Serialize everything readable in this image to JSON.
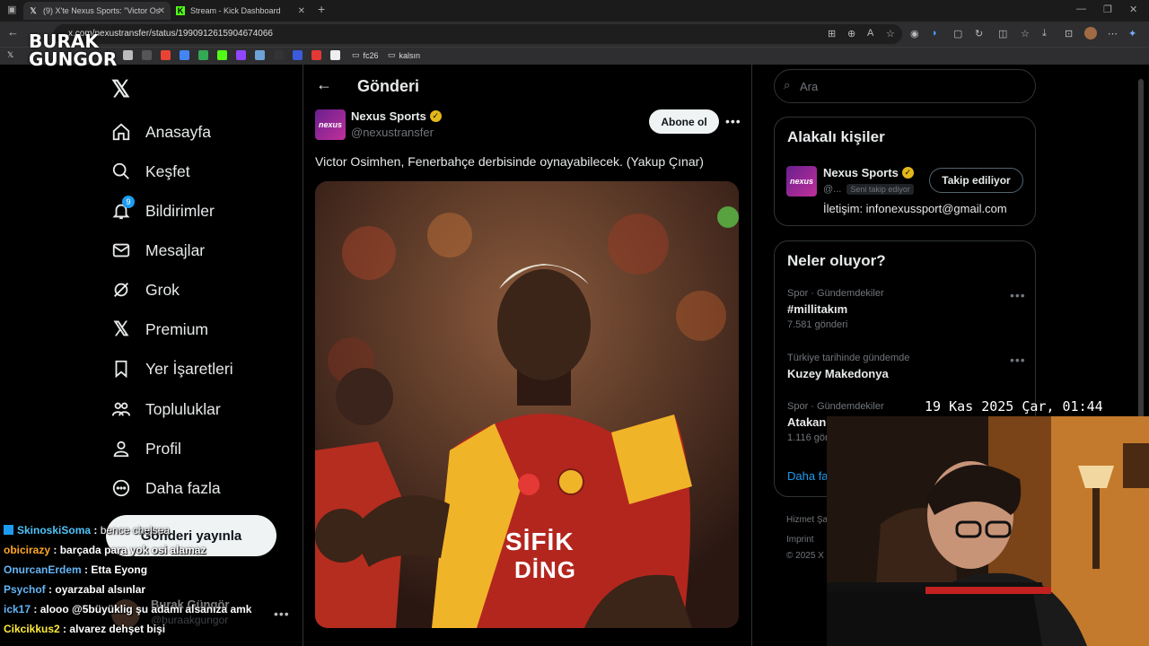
{
  "browser": {
    "tabs": [
      {
        "title": "(9) X'te Nexus Sports: \"Victor Os",
        "icon": "x-logo-icon"
      },
      {
        "title": "Stream - Kick Dashboard",
        "icon": "kick-icon"
      }
    ],
    "url": "x.com/nexustransfer/status/1990912615904674066",
    "bookmarks": [
      {
        "label": "fc26",
        "icon": "folder-icon"
      },
      {
        "label": "kalsın",
        "icon": "folder-icon"
      }
    ]
  },
  "overlay": {
    "logo_line1": "BURAK",
    "logo_line2": "GUNGOR",
    "clock": "19 Kas 2025 Çar, 01:44"
  },
  "nav": {
    "items": [
      {
        "label": "Anasayfa",
        "icon": "home-icon"
      },
      {
        "label": "Keşfet",
        "icon": "search-icon"
      },
      {
        "label": "Bildirimler",
        "icon": "bell-icon",
        "badge": "9"
      },
      {
        "label": "Mesajlar",
        "icon": "mail-icon"
      },
      {
        "label": "Grok",
        "icon": "grok-icon"
      },
      {
        "label": "Premium",
        "icon": "x-logo-icon"
      },
      {
        "label": "Yer İşaretleri",
        "icon": "bookmark-icon"
      },
      {
        "label": "Topluluklar",
        "icon": "communities-icon"
      },
      {
        "label": "Profil",
        "icon": "profile-icon"
      },
      {
        "label": "Daha fazla",
        "icon": "more-circle-icon"
      }
    ],
    "post_button": "Gönderi yayınla",
    "account_name": "Burak Güngör",
    "account_handle": "@buraakgungor"
  },
  "post": {
    "header_title": "Gönderi",
    "author_name": "Nexus Sports",
    "author_handle": "@nexustransfer",
    "follow_label": "Abone ol",
    "text": "Victor Osimhen, Fenerbahçe derbisinde oynayabilecek. (Yakup Çınar)",
    "image_alt": "Victor Osimhen in Galatasaray jersey",
    "jersey_sponsor_1": "SİFİK",
    "jersey_sponsor_2": "DİNG"
  },
  "right": {
    "search_placeholder": "Ara",
    "related_title": "Alakalı kişiler",
    "related_name": "Nexus Sports",
    "related_handle": "@...",
    "related_follows_you": "Seni takip ediyor",
    "related_following_btn": "Takip ediliyor",
    "related_bio": "İletişim: infonexussport@gmail.com",
    "trends_title": "Neler oluyor?",
    "trends": [
      {
        "meta": "Spor · Gündemdekiler",
        "name": "#millitakım",
        "count": "7.581 gönderi"
      },
      {
        "meta": "Türkiye tarihinde gündemde",
        "name": "Kuzey Makedonya",
        "count": ""
      },
      {
        "meta": "Spor · Gündemdekiler",
        "name": "Atakan",
        "count": "1.116 gönde"
      }
    ],
    "show_more": "Daha fa",
    "footer_1": "Hizmet Şar",
    "footer_2": "Imprint",
    "footer_3": "© 2025 X C"
  },
  "chat": [
    {
      "user": "SkinoskiSoma",
      "msg": "bence chelsea",
      "color": "#4fc3f7"
    },
    {
      "user": "obicirazy",
      "msg": "barçada para yok osi alamaz",
      "color": "#ffa726"
    },
    {
      "user": "OnurcanErdem",
      "msg": "Etta Eyong",
      "color": "#64b5f6"
    },
    {
      "user": "Psychof",
      "msg": "oyarzabal alsınlar",
      "color": "#64b5f6"
    },
    {
      "user": "ick17",
      "msg": "alooo @5büyüklig şu adamı alsanıza amk",
      "color": "#64b5f6"
    },
    {
      "user": "Cikcikkus2",
      "msg": "alvarez dehşet bişi",
      "color": "#ffeb3b"
    }
  ]
}
